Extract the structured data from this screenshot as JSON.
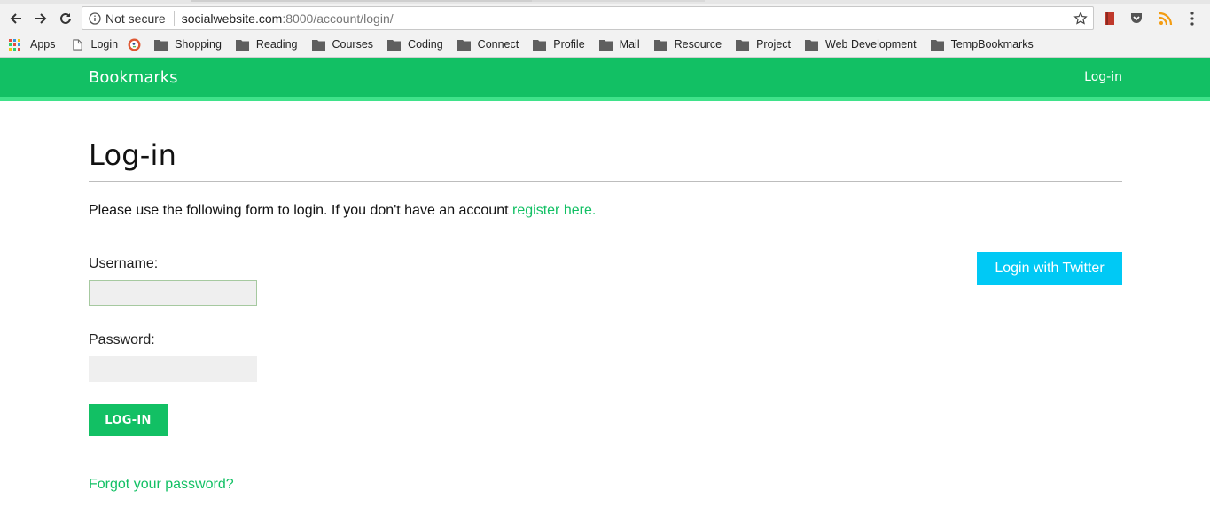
{
  "browser": {
    "security_label": "Not secure",
    "url_host": "socialwebsite.com",
    "url_rest": ":8000/account/login/",
    "bookmarks": [
      {
        "label": "Apps",
        "type": "apps"
      },
      {
        "label": "Login",
        "type": "page"
      },
      {
        "label": "",
        "type": "ddg"
      },
      {
        "label": "Shopping",
        "type": "folder"
      },
      {
        "label": "Reading",
        "type": "folder"
      },
      {
        "label": "Courses",
        "type": "folder"
      },
      {
        "label": "Coding",
        "type": "folder"
      },
      {
        "label": "Connect",
        "type": "folder"
      },
      {
        "label": "Profile",
        "type": "folder"
      },
      {
        "label": "Mail",
        "type": "folder"
      },
      {
        "label": "Resource",
        "type": "folder"
      },
      {
        "label": "Project",
        "type": "folder"
      },
      {
        "label": "Web Development",
        "type": "folder"
      },
      {
        "label": "TempBookmarks",
        "type": "folder"
      }
    ]
  },
  "site": {
    "brand": "Bookmarks",
    "nav_login": "Log-in"
  },
  "page": {
    "title": "Log-in",
    "intro_text": "Please use the following form to login. If you don't have an account ",
    "register_link": "register here.",
    "username_label": "Username:",
    "username_value": "",
    "password_label": "Password:",
    "password_value": "",
    "submit_label": "LOG-IN",
    "forgot_link": "Forgot your password?",
    "twitter_button": "Login with Twitter"
  },
  "colors": {
    "brand_green": "#12c064",
    "twitter_blue": "#00c9f5"
  }
}
